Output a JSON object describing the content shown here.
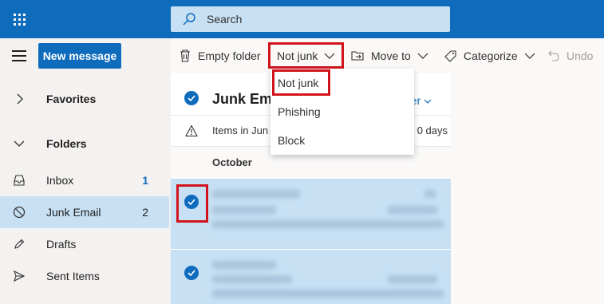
{
  "topbar": {
    "app_launcher_icon": "waffle-icon",
    "search_placeholder": "Search",
    "accent": "#0f6cbd"
  },
  "toolbar": {
    "new_message": "New message",
    "empty_folder": "Empty folder",
    "not_junk": "Not junk",
    "move_to": "Move to",
    "categorize": "Categorize",
    "undo": "Undo"
  },
  "sidebar": {
    "favorites": "Favorites",
    "folders": "Folders",
    "items": [
      {
        "label": "Inbox",
        "count": "1",
        "icon": "inbox-icon"
      },
      {
        "label": "Junk Email",
        "count": "2",
        "icon": "blocked-icon"
      },
      {
        "label": "Drafts",
        "count": "",
        "icon": "pencil-icon"
      },
      {
        "label": "Sent Items",
        "count": "",
        "icon": "send-icon"
      }
    ]
  },
  "list": {
    "folder_title": "Junk Ema",
    "filter": "er",
    "notice": "Items in Jun",
    "notice_days": "0 days",
    "month": "October"
  },
  "dropdown": {
    "items": [
      "Not junk",
      "Phishing",
      "Block"
    ]
  },
  "colors": {
    "highlight": "#d1141c",
    "selected": "#c7e0f4"
  }
}
